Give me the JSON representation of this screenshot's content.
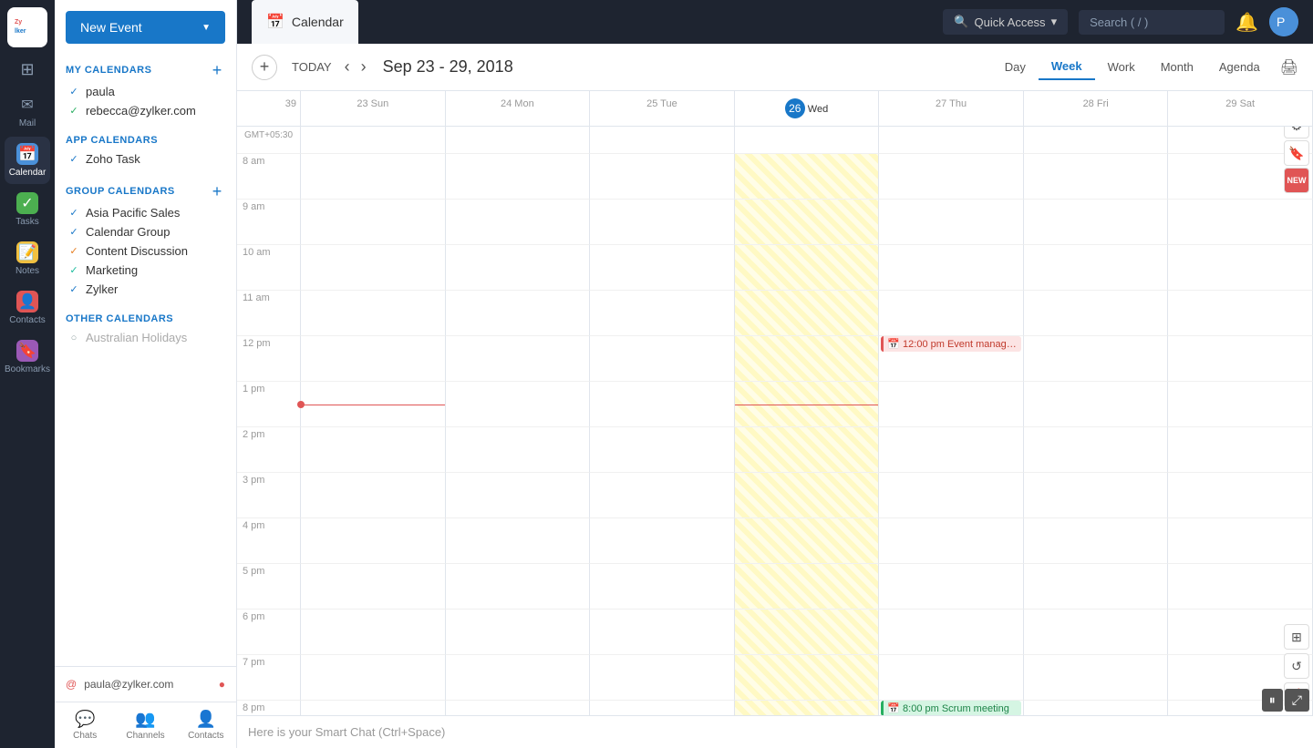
{
  "app": {
    "logo_text": "Zylker"
  },
  "nav": {
    "items": [
      {
        "id": "grid",
        "label": "",
        "icon": "⊞",
        "active": false
      },
      {
        "id": "mail",
        "label": "Mail",
        "icon": "✉",
        "active": false
      },
      {
        "id": "calendar",
        "label": "Calendar",
        "icon": "📅",
        "active": true
      },
      {
        "id": "tasks",
        "label": "Tasks",
        "icon": "✓",
        "active": false
      },
      {
        "id": "notes",
        "label": "Notes",
        "icon": "📝",
        "active": false
      },
      {
        "id": "contacts",
        "label": "Contacts",
        "icon": "👤",
        "active": false
      },
      {
        "id": "bookmarks",
        "label": "Bookmarks",
        "icon": "🔖",
        "active": false
      }
    ]
  },
  "top_bar": {
    "tab_label": "Calendar",
    "quick_access_label": "Quick Access",
    "search_placeholder": "Search ( / )"
  },
  "sidebar": {
    "new_event_label": "New Event",
    "my_calendars_label": "MY CALENDARS",
    "app_calendars_label": "APP CALENDARS",
    "group_calendars_label": "GROUP CALENDARS",
    "other_calendars_label": "OTHER CALENDARS",
    "my_calendars": [
      {
        "name": "paula",
        "color": "blue"
      },
      {
        "name": "rebecca@zylker.com",
        "color": "green"
      }
    ],
    "app_calendars": [
      {
        "name": "Zoho Task",
        "color": "blue"
      }
    ],
    "group_calendars": [
      {
        "name": "Asia Pacific Sales",
        "color": "blue"
      },
      {
        "name": "Calendar Group",
        "color": "blue"
      },
      {
        "name": "Content Discussion",
        "color": "orange"
      },
      {
        "name": "Marketing",
        "color": "teal"
      },
      {
        "name": "Zylker",
        "color": "blue"
      }
    ],
    "other_calendars": [
      {
        "name": "Australian Holidays",
        "color": "gray"
      }
    ],
    "user_email": "paula@zylker.com"
  },
  "calendar": {
    "title": "Sep 23 - 29, 2018",
    "today_label": "TODAY",
    "week_number": "39",
    "view_buttons": [
      "Day",
      "Week",
      "Work",
      "Month",
      "Agenda"
    ],
    "active_view": "Week",
    "days": [
      {
        "num": "23",
        "name": "Sun",
        "today": false
      },
      {
        "num": "24",
        "name": "Mon",
        "today": false
      },
      {
        "num": "25",
        "name": "Tue",
        "today": false
      },
      {
        "num": "26",
        "name": "Wed",
        "today": true
      },
      {
        "num": "27",
        "name": "Thu",
        "today": false
      },
      {
        "num": "28",
        "name": "Fri",
        "today": false
      },
      {
        "num": "29",
        "name": "Sat",
        "today": false
      }
    ],
    "timezone": "GMT+05:30",
    "time_slots": [
      "8 am",
      "9 am",
      "10 am",
      "11 am",
      "12 pm",
      "1 pm",
      "2 pm",
      "3 pm",
      "4 pm",
      "5 pm",
      "6 pm",
      "7 pm",
      "8 pm"
    ],
    "events": [
      {
        "day_index": 4,
        "label": "12:00 pm Event manage...",
        "type": "pink",
        "time_index": 4,
        "top_offset": 0,
        "height": 50
      },
      {
        "day_index": 4,
        "label": "8:00 pm Scrum meeting",
        "type": "green",
        "time_index": 12,
        "top_offset": 0,
        "height": 50
      }
    ]
  },
  "chat": {
    "placeholder": "Here is your Smart Chat (Ctrl+Space)"
  },
  "bottom_nav": [
    {
      "id": "chats",
      "label": "Chats",
      "icon": "💬"
    },
    {
      "id": "channels",
      "label": "Channels",
      "icon": "👥"
    },
    {
      "id": "contacts",
      "label": "Contacts",
      "icon": "👤"
    }
  ]
}
